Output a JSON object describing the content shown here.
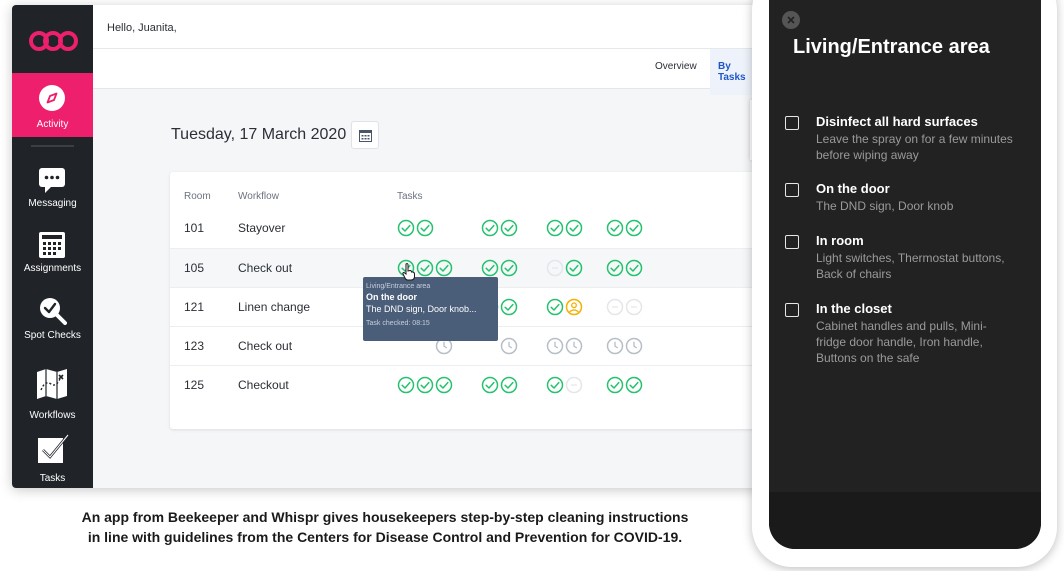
{
  "app": {
    "greeting": "Hello, Juanita,",
    "colors": {
      "accent": "#ee1f6d",
      "sidebar": "#202429",
      "link": "#1d56c8",
      "check": "#25c26e",
      "warning": "#f5b000"
    },
    "nav": [
      {
        "label": "Activity",
        "icon": "compass-icon",
        "active": true
      },
      {
        "label": "Messaging",
        "icon": "chat-bubble-icon",
        "active": false
      },
      {
        "label": "Assignments",
        "icon": "calendar-grid-icon",
        "active": false
      },
      {
        "label": "Spot Checks",
        "icon": "magnifier-check-icon",
        "active": false
      },
      {
        "label": "Workflows",
        "icon": "map-icon",
        "active": false
      },
      {
        "label": "Tasks",
        "icon": "checkbox-icon",
        "active": false
      }
    ],
    "tabs": [
      {
        "label": "Overview",
        "active": false
      },
      {
        "label": "By Tasks",
        "active": true
      }
    ],
    "date": "Tuesday, 17 March 2020",
    "table": {
      "headers": {
        "room": "Room",
        "workflow": "Workflow",
        "tasks": "Tasks"
      },
      "rows": [
        {
          "room": "101",
          "workflow": "Stayover",
          "groups": [
            [
              "done",
              "done"
            ],
            [
              "done",
              "done"
            ],
            [
              "done",
              "done"
            ],
            [
              "done",
              "done"
            ]
          ]
        },
        {
          "room": "105",
          "workflow": "Check out",
          "groups": [
            [
              "done",
              "done",
              "done"
            ],
            [
              "done",
              "done"
            ],
            [
              "none",
              "done"
            ],
            [
              "done",
              "done"
            ]
          ]
        },
        {
          "room": "121",
          "workflow": "Linen change",
          "groups": [
            [
              "hidden",
              "hidden",
              "done"
            ],
            [
              "done",
              "done"
            ],
            [
              "done",
              "person"
            ],
            [
              "none",
              "none"
            ]
          ]
        },
        {
          "room": "123",
          "workflow": "Check out",
          "groups": [
            [
              "hidden",
              "hidden",
              "clock"
            ],
            [
              "hidden",
              "clock"
            ],
            [
              "clock",
              "clock"
            ],
            [
              "clock",
              "clock"
            ]
          ]
        },
        {
          "room": "125",
          "workflow": "Checkout",
          "groups": [
            [
              "done",
              "done",
              "done"
            ],
            [
              "done",
              "done"
            ],
            [
              "done",
              "none"
            ],
            [
              "done",
              "done"
            ]
          ]
        }
      ]
    },
    "tooltip": {
      "area": "Living/Entrance area",
      "title": "On the door",
      "detail": "The DND sign, Door knob...",
      "checked": "Task checked: 08:15"
    }
  },
  "caption": {
    "line1": "An app from Beekeeper and Whispr gives housekeepers step-by-step cleaning instructions",
    "line2": "in line with guidelines from the Centers for Disease Control and Prevention for COVID-19."
  },
  "phone": {
    "title": "Living/Entrance area",
    "items": [
      {
        "title": "Disinfect all hard surfaces",
        "desc": "Leave the spray on for a few minutes before wiping away"
      },
      {
        "title": "On the door",
        "desc": "The DND sign, Door knob"
      },
      {
        "title": "In room",
        "desc": "Light switches, Thermostat buttons, Back of chairs"
      },
      {
        "title": "In the closet",
        "desc": "Cabinet handles and pulls, Mini-fridge door handle, Iron handle, Buttons on the safe"
      }
    ]
  }
}
